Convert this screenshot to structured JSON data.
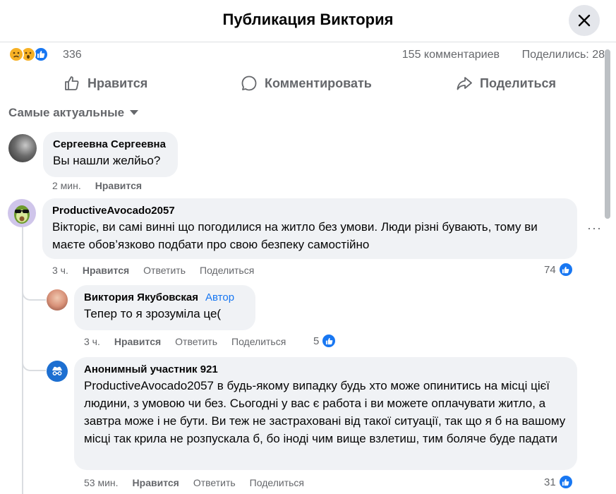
{
  "header": {
    "title": "Публикация Виктория"
  },
  "stats": {
    "reactions_count": "336",
    "comments": "155 комментариев",
    "shares": "Поделились: 28"
  },
  "actions": {
    "like": "Нравится",
    "comment": "Комментировать",
    "share": "Поделиться"
  },
  "sort_label": "Самые актуальные",
  "comments": [
    {
      "author": "Сергеевна Сергеевна",
      "text": "Вы нашли желйьо?",
      "time": "2 мин.",
      "like": "Нравится"
    },
    {
      "author": "ProductiveAvocado2057",
      "text": "Вікторіє, ви самі винні що погодилися на житло без умови. Люди різні бувають, тому ви маєте обов’язково подбати про свою безпеку самостійно",
      "time": "3 ч.",
      "like": "Нравится",
      "reply": "Ответить",
      "share": "Поделиться",
      "likes": "74"
    },
    {
      "author": "Виктория Якубовская",
      "badge": "Автор",
      "text": "Тепер то я зрозуміла це(",
      "time": "3 ч.",
      "like": "Нравится",
      "reply": "Ответить",
      "share": "Поделиться",
      "likes": "5"
    },
    {
      "author": "Анонимный участник 921",
      "text": "ProductiveAvocado2057 в будь-якому випадку будь хто може опинитись на місці цієї людини, з умовою чи без. Сьогодні у вас є работа і ви можете оплачувати житло, а завтра може і не бути. Ви теж не застраховані від такої ситуації, так що я б на вашому місці так крила не розпускала б, бо іноді чим вище взлетиш, тим боляче буде падати",
      "time": "53 мин.",
      "like": "Нравится",
      "reply": "Ответить",
      "share": "Поделиться",
      "likes": "31"
    }
  ],
  "colors": {
    "accent": "#1877f2",
    "bubble": "#f0f2f5",
    "muted": "#65676b"
  }
}
